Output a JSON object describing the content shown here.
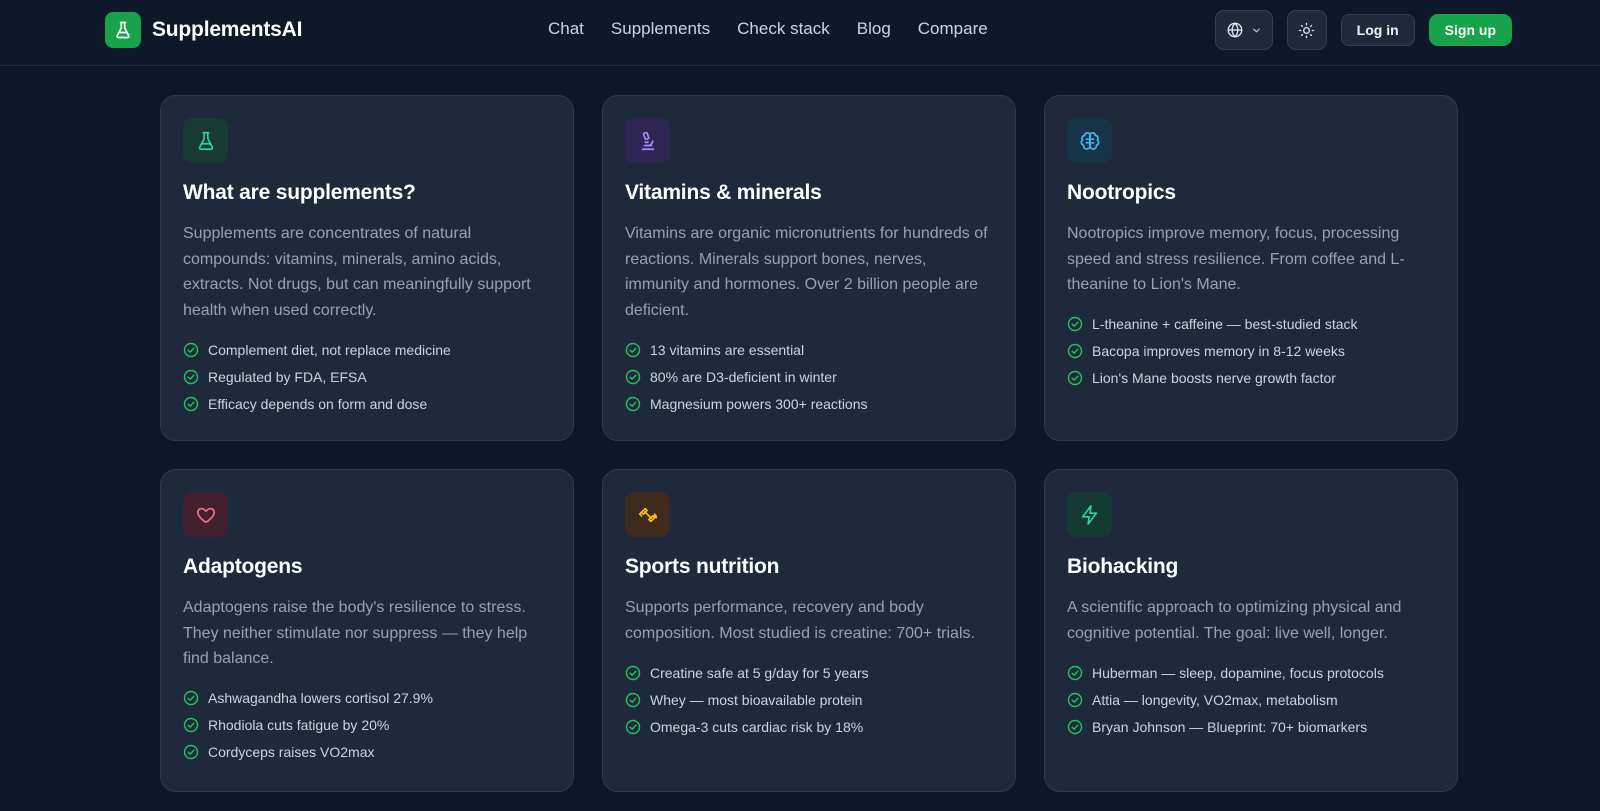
{
  "header": {
    "brand": "SupplementsAI",
    "nav": [
      "Chat",
      "Supplements",
      "Check stack",
      "Blog",
      "Compare"
    ],
    "login_label": "Log in",
    "signup_label": "Sign up"
  },
  "colors": {
    "background": "#0f172a",
    "card": "#1e293b",
    "accent": "#16a34a",
    "check": "#22c55e"
  },
  "cards": [
    {
      "icon": "flask-icon",
      "title": "What are supplements?",
      "description": "Supplements are concentrates of natural compounds: vitamins, minerals, amino acids, extracts. Not drugs, but can meaningfully support health when used correctly.",
      "points": [
        "Complement diet, not replace medicine",
        "Regulated by FDA, EFSA",
        "Efficacy depends on form and dose"
      ]
    },
    {
      "icon": "microscope-icon",
      "title": "Vitamins & minerals",
      "description": "Vitamins are organic micronutrients for hundreds of reactions. Minerals support bones, nerves, immunity and hormones. Over 2 billion people are deficient.",
      "points": [
        "13 vitamins are essential",
        "80% are D3-deficient in winter",
        "Magnesium powers 300+ reactions"
      ]
    },
    {
      "icon": "brain-icon",
      "title": "Nootropics",
      "description": "Nootropics improve memory, focus, processing speed and stress resilience. From coffee and L-theanine to Lion's Mane.",
      "points": [
        "L-theanine + caffeine — best-studied stack",
        "Bacopa improves memory in 8-12 weeks",
        "Lion's Mane boosts nerve growth factor"
      ]
    },
    {
      "icon": "heart-icon",
      "title": "Adaptogens",
      "description": "Adaptogens raise the body's resilience to stress. They neither stimulate nor suppress — they help find balance.",
      "points": [
        "Ashwagandha lowers cortisol 27.9%",
        "Rhodiola cuts fatigue by 20%",
        "Cordyceps raises VO2max"
      ]
    },
    {
      "icon": "dumbbell-icon",
      "title": "Sports nutrition",
      "description": "Supports performance, recovery and body composition. Most studied is creatine: 700+ trials.",
      "points": [
        "Creatine safe at 5 g/day for 5 years",
        "Whey — most bioavailable protein",
        "Omega-3 cuts cardiac risk by 18%"
      ]
    },
    {
      "icon": "lightning-icon",
      "title": "Biohacking",
      "description": "A scientific approach to optimizing physical and cognitive potential. The goal: live well, longer.",
      "points": [
        "Huberman — sleep, dopamine, focus protocols",
        "Attia — longevity, VO2max, metabolism",
        "Bryan Johnson — Blueprint: 70+ biomarkers"
      ]
    }
  ]
}
